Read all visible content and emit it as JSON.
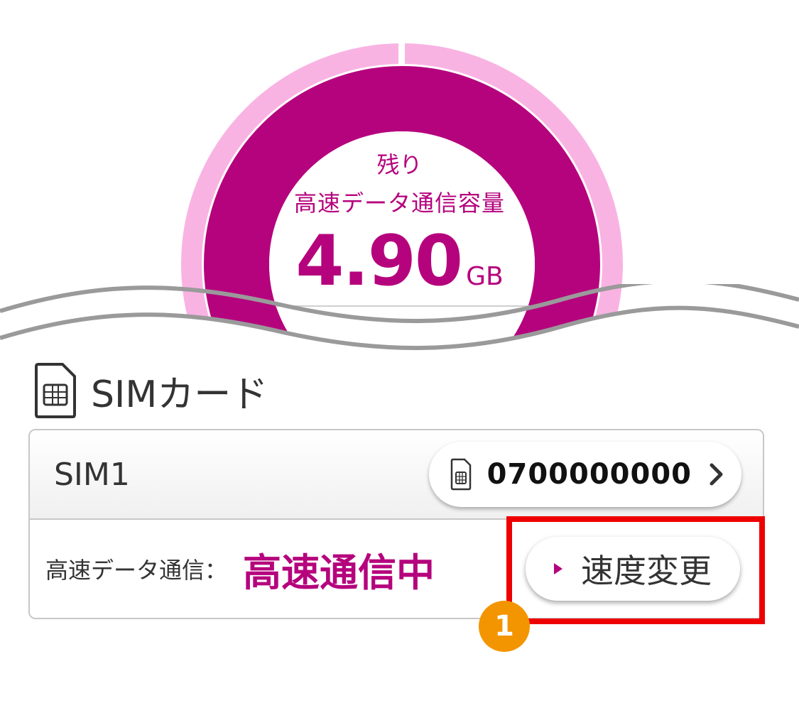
{
  "gauge": {
    "label": "残り",
    "sublabel": "高速データ通信容量",
    "value": "4.90",
    "unit": "GB",
    "colors": {
      "primary": "#b5037d",
      "track": "#f9b3e3"
    }
  },
  "sim_section": {
    "title": "SIMカード",
    "icon": "sim-card-icon"
  },
  "sim_card": {
    "name": "SIM1",
    "phone_number": "0700000000",
    "status_label": "高速データ通信：",
    "status_value": "高速通信中",
    "speed_button_label": "速度変更"
  },
  "annotation": {
    "step_number": "1",
    "highlight_color": "#ee0000",
    "badge_color": "#f39500"
  }
}
